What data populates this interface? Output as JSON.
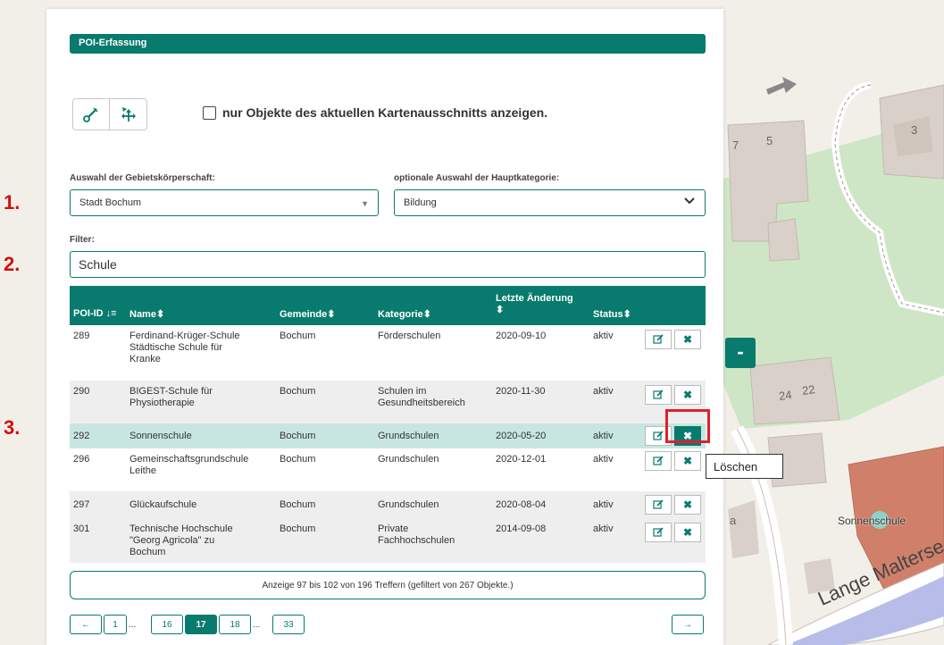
{
  "panel": {
    "title": "POI-Erfassung",
    "checkbox_label": "nur Objekte des aktuellen Kartenausschnitts anzeigen.",
    "label_gebiet": "Auswahl der Gebietskörperschaft:",
    "label_kategorie": "optionale Auswahl der Hauptkategorie:",
    "select_gebiet": "Stadt Bochum",
    "select_kategorie": "Bildung",
    "filter_label": "Filter:",
    "filter_value": "Schule"
  },
  "table": {
    "headers": {
      "id": "POI-ID",
      "name": "Name",
      "gemeinde": "Gemeinde",
      "kategorie": "Kategorie",
      "aenderung_1": "Letzte Änderung",
      "status": "Status"
    },
    "rows": [
      {
        "id": "289",
        "name1": "Ferdinand-Krüger-Schule",
        "name2": "Städtische Schule für",
        "name3": "Kranke",
        "gemeinde": "Bochum",
        "kat1": "Förderschulen",
        "kat2": "",
        "datum": "2020-09-10",
        "status": "aktiv"
      },
      {
        "id": "290",
        "name1": "BIGEST-Schule für",
        "name2": "Physiotherapie",
        "name3": "",
        "gemeinde": "Bochum",
        "kat1": "Schulen im",
        "kat2": "Gesundheitsbereich",
        "datum": "2020-11-30",
        "status": "aktiv"
      },
      {
        "id": "292",
        "name1": "Sonnenschule",
        "name2": "",
        "name3": "",
        "gemeinde": "Bochum",
        "kat1": "Grundschulen",
        "kat2": "",
        "datum": "2020-05-20",
        "status": "aktiv"
      },
      {
        "id": "296",
        "name1": "Gemeinschaftsgrundschule",
        "name2": "Leithe",
        "name3": "",
        "gemeinde": "Bochum",
        "kat1": "Grundschulen",
        "kat2": "",
        "datum": "2020-12-01",
        "status": "aktiv"
      },
      {
        "id": "297",
        "name1": "Glückaufschule",
        "name2": "",
        "name3": "",
        "gemeinde": "Bochum",
        "kat1": "Grundschulen",
        "kat2": "",
        "datum": "2020-08-04",
        "status": "aktiv"
      },
      {
        "id": "301",
        "name1": "Technische Hochschule",
        "name2": "\"Georg Agricola\" zu",
        "name3": "Bochum",
        "gemeinde": "Bochum",
        "kat1": "Private",
        "kat2": "Fachhochschulen",
        "datum": "2014-09-08",
        "status": "aktiv"
      }
    ]
  },
  "info": "Anzeige 97 bis 102 von 196 Treffern (gefiltert von 267 Objekte.)",
  "pagination": {
    "prev": "←",
    "next": "→",
    "pages": [
      "1",
      "16",
      "17",
      "18",
      "33"
    ],
    "ellipsis": "...",
    "active": "17"
  },
  "annotations": {
    "one": "1.",
    "two": "2.",
    "three": "3."
  },
  "tooltip": "Löschen",
  "map": {
    "minus": "-",
    "labels": {
      "h7": "7",
      "h5": "5",
      "h3": "3",
      "h24": "24",
      "h22": "22",
      "ha": "a",
      "school": "Sonnenschule",
      "street": "Lange Malterse"
    }
  },
  "colors": {
    "accent": "#087a6e",
    "highlight_row": "#c8e6e1",
    "annotation_red": "#d01010"
  }
}
